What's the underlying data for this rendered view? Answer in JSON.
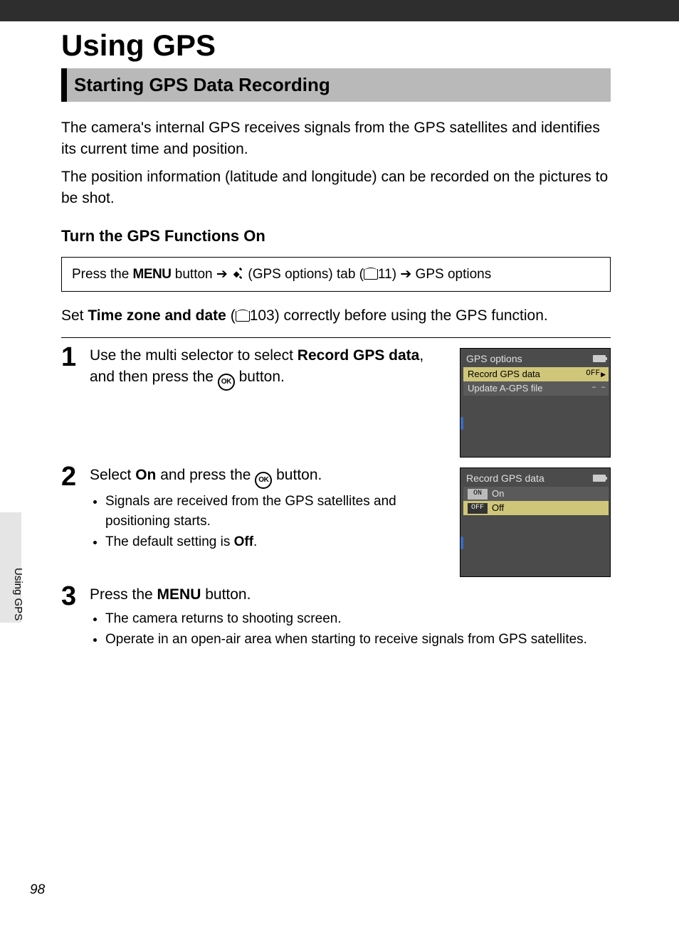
{
  "page_number": "98",
  "side_label": "Using GPS",
  "title": "Using GPS",
  "section_title": "Starting GPS Data Recording",
  "intro_p1": "The camera's internal GPS receives signals from the GPS satellites and identifies its current time and position.",
  "intro_p2": "The position information (latitude and longitude) can be recorded on the pictures to be shot.",
  "subhead": "Turn the GPS Functions On",
  "nav": {
    "prefix": "Press the ",
    "menu_label": "MENU",
    "after_menu": " button ",
    "arrow": "➔",
    "tab_text": " (GPS options) tab (",
    "page_ref": "11",
    "after_ref": ") ",
    "end": " GPS options"
  },
  "set_line": {
    "prefix": "Set ",
    "bold": "Time zone and date",
    "mid": " (",
    "page_ref": "103",
    "suffix": ") correctly before using the GPS function."
  },
  "steps": [
    {
      "num": "1",
      "instr_parts": {
        "a": "Use the multi selector to select ",
        "b_bold": "Record GPS data",
        "c": ", and then press the ",
        "ok": "OK",
        "d": " button."
      },
      "bullets": [],
      "lcd": {
        "title": "GPS options",
        "rows": [
          {
            "label": "Record GPS data",
            "val": "OFF",
            "sel": true,
            "arrow": true
          },
          {
            "label": "Update A-GPS file",
            "val": "– –",
            "sel": false
          }
        ]
      }
    },
    {
      "num": "2",
      "instr_parts": {
        "a": "Select ",
        "b_bold": "On",
        "c": " and press the ",
        "ok": "OK",
        "d": " button."
      },
      "bullets": [
        {
          "plain": "Signals are received from the GPS satellites and positioning starts."
        },
        {
          "pre": "The default setting is ",
          "bold": "Off",
          "post": "."
        }
      ],
      "lcd": {
        "title": "Record GPS data",
        "rows": [
          {
            "tag": "ON",
            "label": "On",
            "sel": false
          },
          {
            "tag": "OFF",
            "label": "Off",
            "sel": true
          }
        ]
      }
    },
    {
      "num": "3",
      "instr_parts": {
        "a": "Press the ",
        "menu": "MENU",
        "d": " button."
      },
      "bullets": [
        {
          "plain": "The camera returns to shooting screen."
        },
        {
          "plain": "Operate in an open-air area when starting to receive signals from GPS satellites."
        }
      ]
    }
  ]
}
